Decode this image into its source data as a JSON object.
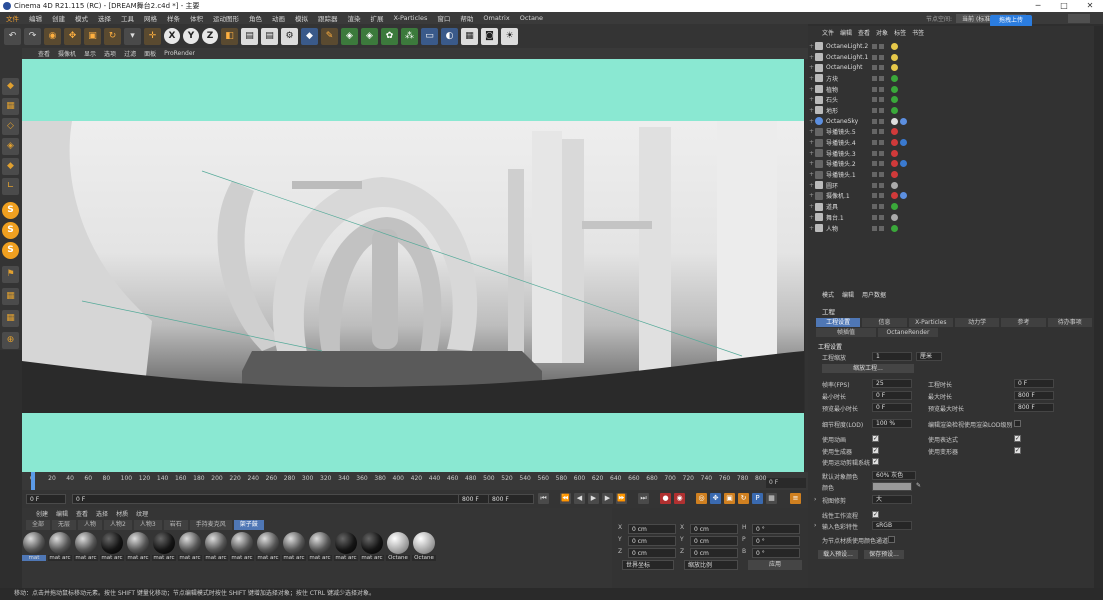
{
  "window": {
    "title": "Cinema 4D R21.115 (RC) - [DREAM舞台2.c4d *] - 主要",
    "controls": [
      "─",
      "□",
      "✕"
    ]
  },
  "menubar": [
    "文件",
    "编辑",
    "创建",
    "模式",
    "选择",
    "工具",
    "网格",
    "样条",
    "体积",
    "运动图形",
    "角色",
    "动画",
    "模拟",
    "跟踪器",
    "渲染",
    "扩展",
    "X-Particles",
    "窗口",
    "帮助",
    "Omatrix",
    "Octane"
  ],
  "layout": {
    "label": "节点空间:",
    "value": "当前 (标准/物理)",
    "upload": "拖拽上传"
  },
  "viewport": {
    "menu": [
      "查看",
      "摄像机",
      "显示",
      "选项",
      "过滤",
      "面板",
      "ProRender"
    ]
  },
  "timeline": {
    "ticks": [
      "0",
      "20",
      "40",
      "60",
      "80",
      "100",
      "120",
      "140",
      "160",
      "180",
      "200",
      "220",
      "240",
      "260",
      "280",
      "300",
      "320",
      "340",
      "360",
      "380",
      "400",
      "420",
      "440",
      "460",
      "480",
      "500",
      "520",
      "540",
      "560",
      "580",
      "600",
      "620",
      "640",
      "660",
      "680",
      "700",
      "720",
      "740",
      "760",
      "780",
      "800"
    ],
    "current": "0 F"
  },
  "transport": {
    "start": "0 F",
    "start2": "0 F",
    "end": "800 F",
    "end2": "800 F"
  },
  "material": {
    "menu": [
      "创建",
      "编辑",
      "查看",
      "选择",
      "材质",
      "纹理"
    ],
    "tabs": [
      "全部",
      "无层",
      "人物",
      "人物2",
      "人物3",
      "岩石",
      "手持麦克风",
      "架子鼓"
    ],
    "balls": [
      "mat",
      "mat arc",
      "mat arc",
      "mat arc",
      "mat arc",
      "mat arc",
      "mat arc",
      "mat arc",
      "mat arc",
      "mat arc",
      "mat arc",
      "mat arc",
      "mat arc",
      "mat arc",
      "Octane",
      "Octane"
    ]
  },
  "coords": {
    "rows": [
      [
        "X",
        "0 cm",
        "X",
        "0 cm",
        "H",
        "0 °"
      ],
      [
        "Y",
        "0 cm",
        "Y",
        "0 cm",
        "P",
        "0 °"
      ],
      [
        "Z",
        "0 cm",
        "Z",
        "0 cm",
        "B",
        "0 °"
      ]
    ],
    "mode1": "世界坐标",
    "mode2": "缩放比例",
    "apply": "应用"
  },
  "objects": {
    "menu": [
      "文件",
      "编辑",
      "查看",
      "对象",
      "标签",
      "书签"
    ],
    "items": [
      {
        "name": "OctaneLight.2",
        "icon": "null"
      },
      {
        "name": "OctaneLight.1",
        "icon": "null"
      },
      {
        "name": "OctaneLight",
        "icon": "null"
      },
      {
        "name": "方块",
        "icon": "null"
      },
      {
        "name": "植物",
        "icon": "null"
      },
      {
        "name": "石头",
        "icon": "null"
      },
      {
        "name": "地形",
        "icon": "null"
      },
      {
        "name": "OctaneSky",
        "icon": "sky"
      },
      {
        "name": "导播镜头.5",
        "icon": "cam"
      },
      {
        "name": "导播镜头.4",
        "icon": "cam"
      },
      {
        "name": "导播镜头.3",
        "icon": "cam"
      },
      {
        "name": "导播镜头.2",
        "icon": "cam"
      },
      {
        "name": "导播镜头.1",
        "icon": "cam"
      },
      {
        "name": "圆环",
        "icon": "null"
      },
      {
        "name": "摄像机.1",
        "icon": "cam"
      },
      {
        "name": "道具",
        "icon": "null"
      },
      {
        "name": "舞台.1",
        "icon": "null"
      },
      {
        "name": "人物",
        "icon": "null"
      }
    ]
  },
  "attributes": {
    "menu": [
      "模式",
      "编辑",
      "用户数据"
    ],
    "title": "工程",
    "tabs1": [
      "工程设置",
      "信息",
      "X-Particles",
      "动力学",
      "参考",
      "待办事项"
    ],
    "tabs2": [
      "帧插值",
      "OctaneRender"
    ],
    "section": "工程设置",
    "scale_label": "工程缩放",
    "scale_value": "1",
    "scale_unit": "厘米",
    "scale_btn": "缩放工程...",
    "fps_label": "帧率(FPS)",
    "fps": "25",
    "time_label": "工程时长",
    "time": "0 F",
    "min_label": "最小时长",
    "min": "0 F",
    "max_label": "最大时长",
    "max": "800 F",
    "pmin_label": "预览最小时长",
    "pmin": "0 F",
    "pmax_label": "预览最大时长",
    "pmax": "800 F",
    "lod_label": "细节程度(LOD)",
    "lod": "100 %",
    "lod2_label": "编辑渲染检视使用渲染LOD级别",
    "anim_label": "使用动画",
    "expr_label": "使用表达式",
    "gen_label": "使用生成器",
    "deform_label": "使用变形器",
    "motion_label": "使用运动剪辑系统",
    "defcolor_label": "默认对象颜色",
    "defcolor": "60% 灰色",
    "color_label": "颜色",
    "viewclip_label": "视图修剪",
    "viewclip": "大",
    "linear_label": "线性工作流程",
    "incolor_label": "输入色彩特性",
    "incolor": "sRGB",
    "nodecolor_label": "为节点材质使用颜色通道",
    "load_btn": "载入预设...",
    "save_btn": "保存预设..."
  },
  "status": "移动：点击并拖动鼠标移动元素。按住 SHIFT 键量化移动；节点编辑模式时按住 SHIFT 键增加选择对象；按住 CTRL 键减少选择对象。"
}
